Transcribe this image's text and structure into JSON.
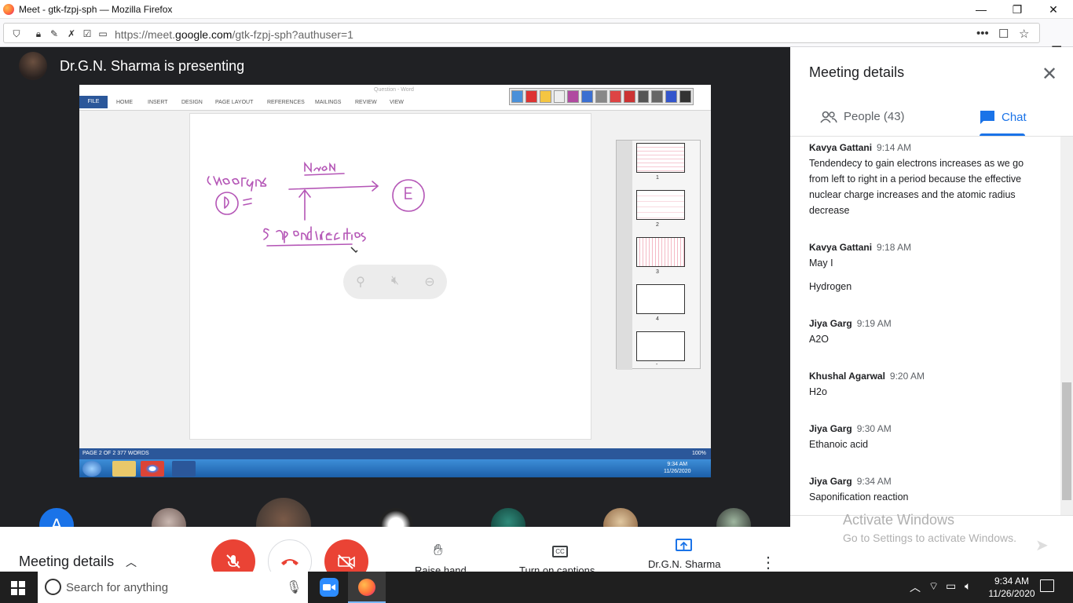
{
  "browser": {
    "window_title": "Meet - gtk-fzpj-sph — Mozilla Firefox",
    "url_prefix": "https://meet.",
    "url_domain": "google.com",
    "url_path": "/gtk-fzpj-sph?authuser=1",
    "min_glyph": "—",
    "max_glyph": "❐",
    "close_glyph": "✕"
  },
  "meet": {
    "presenting_text": "Dr.G.N. Sharma is presenting",
    "shared_screen": {
      "doc_title": "Question - Word",
      "ribbon_tabs": [
        "FILE",
        "HOME",
        "INSERT",
        "DESIGN",
        "PAGE LAYOUT",
        "REFERENCES",
        "MAILINGS",
        "REVIEW",
        "VIEW"
      ],
      "status_left": "PAGE 2 OF 2    377 WORDS",
      "zoom": "100%",
      "slide_numbers": [
        "1",
        "2",
        "3",
        "4",
        "-"
      ],
      "clock_time": "9:34 AM",
      "clock_date": "11/26/2020"
    },
    "controls": {
      "meeting_details": "Meeting details",
      "raise_hand": "Raise hand",
      "captions": "Turn on captions",
      "presenter": "Dr.G.N. Sharma",
      "participant_initial": "A"
    }
  },
  "panel": {
    "title": "Meeting details",
    "tab_people": "People (43)",
    "tab_chat": "Chat",
    "messages": [
      {
        "name": "Kavya Gattani",
        "time": "9:14 AM",
        "lines": [
          "Tendendecy to gain electrons increases as we go from left to right in a period because the effective nuclear charge increases and the atomic radius decrease"
        ]
      },
      {
        "name": "Kavya Gattani",
        "time": "9:18 AM",
        "lines": [
          "May I",
          "Hydrogen"
        ]
      },
      {
        "name": "Jiya Garg",
        "time": "9:19 AM",
        "lines": [
          "A2O"
        ]
      },
      {
        "name": "Khushal Agarwal",
        "time": "9:20 AM",
        "lines": [
          "H2o"
        ]
      },
      {
        "name": "Jiya Garg",
        "time": "9:30 AM",
        "lines": [
          "Ethanoic acid"
        ]
      },
      {
        "name": "Jiya Garg",
        "time": "9:34 AM",
        "lines": [
          "Saponification reaction"
        ]
      }
    ],
    "activate_title": "Activate Windows",
    "activate_sub": "Go to Settings to activate Windows."
  },
  "taskbar": {
    "search_placeholder": "Search for anything",
    "time": "9:34 AM",
    "date": "11/26/2020"
  },
  "colors": {
    "meet_dark": "#202124",
    "accent_blue": "#1a73e8",
    "end_red": "#ea4335",
    "word_blue": "#2b579a"
  }
}
